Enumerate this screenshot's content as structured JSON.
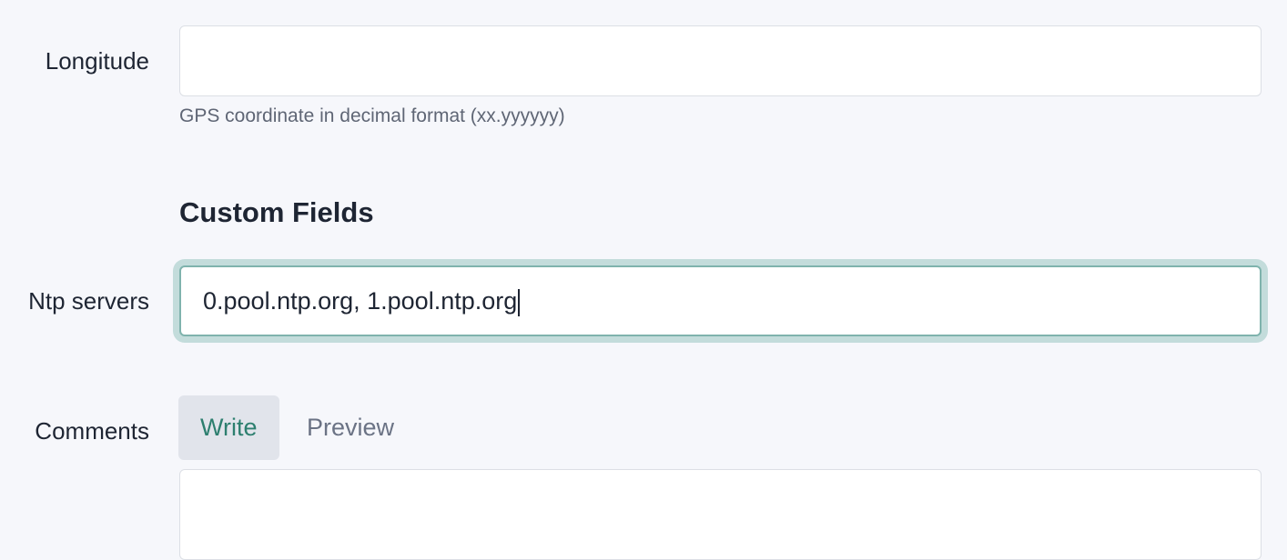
{
  "fields": {
    "longitude": {
      "label": "Longitude",
      "value": "",
      "help": "GPS coordinate in decimal format (xx.yyyyyy)"
    },
    "section_title": "Custom Fields",
    "ntp_servers": {
      "label": "Ntp servers",
      "value": "0.pool.ntp.org, 1.pool.ntp.org"
    },
    "comments": {
      "label": "Comments",
      "tabs": [
        {
          "label": "Write",
          "active": true
        },
        {
          "label": "Preview",
          "active": false
        }
      ],
      "value": ""
    }
  }
}
